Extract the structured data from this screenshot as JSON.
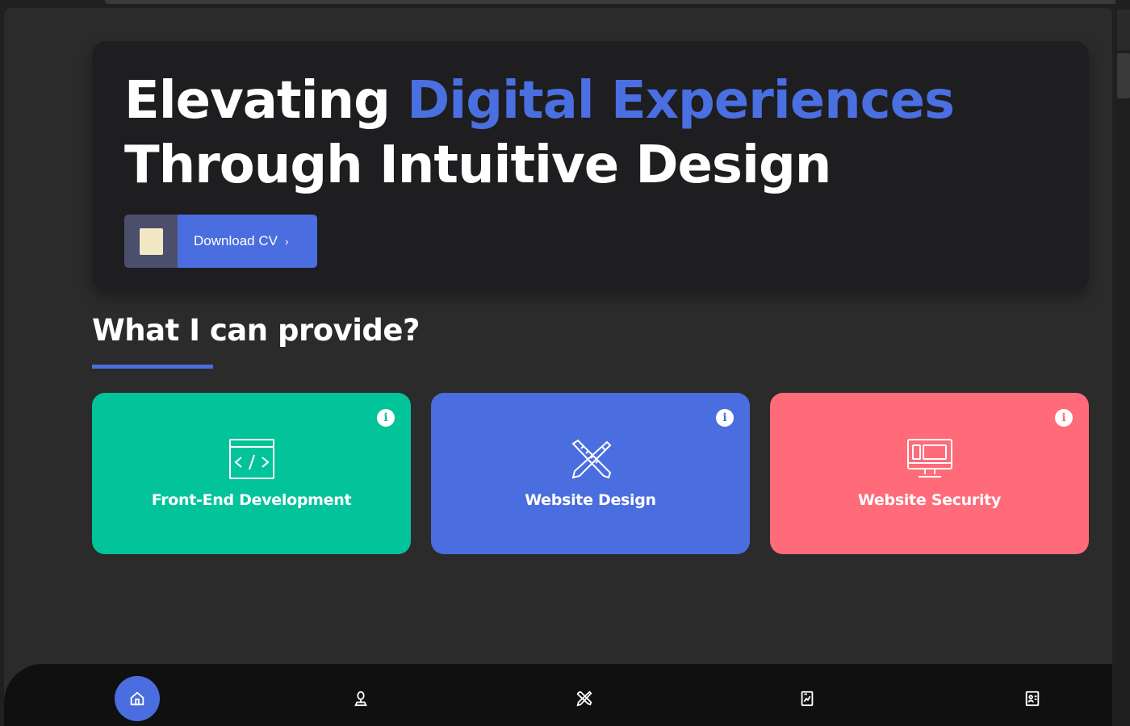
{
  "hero": {
    "title_part1": "Elevating ",
    "title_accent": "Digital Experiences",
    "title_line2": "Through Intuitive Design",
    "cv_button_label": "Download CV",
    "cv_button_chevron": "›"
  },
  "services": {
    "heading": "What I can provide?",
    "cards": [
      {
        "label": "Front-End Development",
        "icon": "code-window-icon",
        "info": "i",
        "color": "#02c39a"
      },
      {
        "label": "Website Design",
        "icon": "pencil-ruler-icon",
        "info": "i",
        "color": "#4a6ddf"
      },
      {
        "label": "Website Security",
        "icon": "monitor-security-icon",
        "info": "i",
        "color": "#ff6b78"
      }
    ]
  },
  "nav": {
    "items": [
      {
        "icon": "home-icon",
        "active": true
      },
      {
        "icon": "person-icon",
        "active": false
      },
      {
        "icon": "tools-icon",
        "active": false
      },
      {
        "icon": "chart-document-icon",
        "active": false
      },
      {
        "icon": "contact-card-icon",
        "active": false
      }
    ]
  },
  "colors": {
    "accent": "#4a6ddf",
    "green": "#02c39a",
    "red": "#ff6b78",
    "hero_bg": "#1e1d20",
    "page_bg": "#2b2b2b"
  }
}
